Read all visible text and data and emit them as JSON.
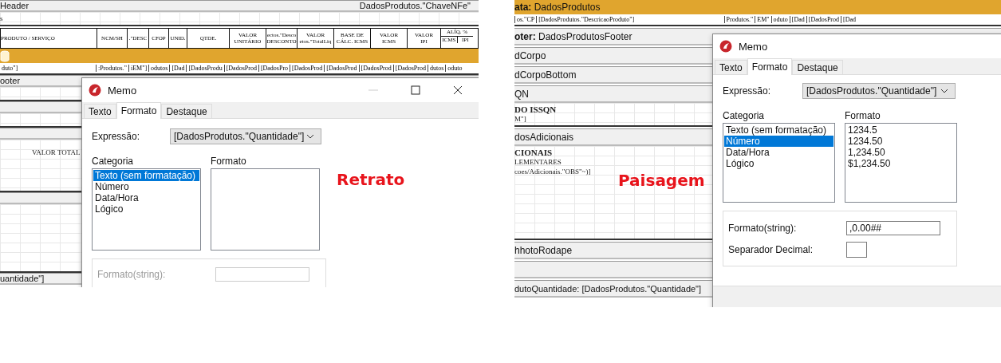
{
  "panels": [
    {
      "caption": "Retrato",
      "rows": [
        {
          "kind": "band",
          "title": "Header",
          "field": "DadosProdutos.\"ChaveNFe\""
        },
        {
          "kind": "grid",
          "lines": [
            {
              "text": "s",
              "bold": false
            }
          ]
        },
        {
          "kind": "table-head",
          "cells": [
            {
              "lines": [
                "PRODUTO / SERVIÇO"
              ]
            },
            {
              "lines": [
                "NCM/SH"
              ]
            },
            {
              "lines": [
                ".\"DESC"
              ]
            },
            {
              "lines": [
                "CFOP"
              ]
            },
            {
              "lines": [
                "UNID."
              ]
            },
            {
              "lines": [
                "QTDE."
              ]
            },
            {
              "lines": [
                "VALOR",
                "UNITÁRIO"
              ]
            },
            {
              "lines": [
                "ectos.\"Desco",
                "DESCONTO"
              ]
            },
            {
              "lines": [
                "VALOR",
                "etos.\"TotalLiq"
              ]
            },
            {
              "lines": [
                "BASE DE",
                "CÁLC. ICMS"
              ]
            },
            {
              "lines": [
                "VALOR",
                "ICMS"
              ]
            },
            {
              "lines": [
                "VALOR",
                "IPI"
              ]
            },
            {
              "lines": [
                "ALÍQ. %"
              ],
              "sub": [
                "ICMS",
                "IPI"
              ]
            }
          ]
        },
        {
          "kind": "orange",
          "icon": true
        },
        {
          "kind": "data-row",
          "cells": [
            "duto\"]",
            ":Produtos.\"",
            "iEM\"]",
            "odutos",
            "[Dad",
            "[DadosProdu",
            "[DadosProd",
            "[DadosPro",
            "[DadosProd",
            "[DadosProd",
            "[DadosProd",
            "[DadosProd",
            "dutos",
            "oduto"
          ]
        },
        {
          "kind": "band",
          "title": "ooter"
        },
        {
          "kind": "grid",
          "lines": []
        },
        {
          "kind": "band"
        },
        {
          "kind": "grid",
          "lines": []
        },
        {
          "kind": "band"
        },
        {
          "kind": "grid",
          "lines": [
            {
              "text": "VALOR TOTAL",
              "bold": false
            }
          ]
        },
        {
          "kind": "band"
        },
        {
          "kind": "grid",
          "lines": []
        },
        {
          "kind": "band",
          "title": "uantidade\"]"
        }
      ],
      "dialog": {
        "title": "Memo",
        "window_controls": true,
        "tabs": [
          {
            "label": "Texto",
            "selected": false
          },
          {
            "label": "Formato",
            "selected": true
          },
          {
            "label": "Destaque",
            "selected": false
          }
        ],
        "expression_label": "Expressão:",
        "expression_value": "[DadosProdutos.\"Quantidade\"]",
        "category_label": "Categoria",
        "categories": [
          {
            "label": "Texto (sem formatação)",
            "selected": true
          },
          {
            "label": "Número",
            "selected": false
          },
          {
            "label": "Data/Hora",
            "selected": false
          },
          {
            "label": "Lógico",
            "selected": false
          }
        ],
        "format_label": "Formato",
        "format_string": {
          "label": "Formato(string):",
          "disabled": true
        }
      }
    },
    {
      "caption": "Paisagem",
      "rows": [
        {
          "kind": "orange",
          "title": "**ata:** DadosProdutos"
        },
        {
          "kind": "data-row",
          "cells": [
            "os.\"CP",
            "[DadosProdutos.\"DescricaoProduto\"]"
          ],
          "right_cells": [
            "Produtos.\"",
            "EM\"",
            "oduto",
            "[Dad",
            "[DadosProd",
            "[Dad"
          ]
        },
        {
          "kind": "band",
          "title": "**oter:** DadosProdutosFooter"
        },
        {
          "kind": "band",
          "title": "dCorpo"
        },
        {
          "kind": "band",
          "title": "dCorpoBottom"
        },
        {
          "kind": "band",
          "title": "QN"
        },
        {
          "kind": "grid",
          "lines": [
            {
              "text": "DO ISSQN",
              "bold": true
            },
            {
              "text": "M\"]",
              "bold": false
            }
          ]
        },
        {
          "kind": "band",
          "title": "dosAdicionais"
        },
        {
          "kind": "grid",
          "lines": [
            {
              "text": "CIONAIS",
              "bold": true
            },
            {
              "text": "LEMENTARES",
              "bold": false
            },
            {
              "text": "coes/Adicionais.\"OBS\"~)]",
              "bold": false
            }
          ]
        },
        {
          "kind": "band",
          "title": "hhotoRodape"
        },
        {
          "kind": "band"
        },
        {
          "kind": "band",
          "title": "dutoQuantidade: [DadosProdutos.\"Quantidade\"]"
        }
      ],
      "dialog": {
        "title": "Memo",
        "tabs": [
          {
            "label": "Texto",
            "selected": false
          },
          {
            "label": "Formato",
            "selected": true
          },
          {
            "label": "Destaque",
            "selected": false
          }
        ],
        "expression_label": "Expressão:",
        "expression_value": "[DadosProdutos.\"Quantidade\"]",
        "category_label": "Categoria",
        "categories": [
          {
            "label": "Texto (sem formatação)",
            "selected": false
          },
          {
            "label": "Número",
            "selected": true
          },
          {
            "label": "Data/Hora",
            "selected": false
          },
          {
            "label": "Lógico",
            "selected": false
          }
        ],
        "format_label": "Formato",
        "formats": [
          "1234.5",
          "1234.50",
          "1,234.50",
          "$1,234.50"
        ],
        "format_string": {
          "label": "Formato(string):",
          "value": ",0.00##",
          "disabled": false
        },
        "decimal_separator": {
          "label": "Separador Decimal:"
        },
        "footer_bar": true
      }
    }
  ]
}
